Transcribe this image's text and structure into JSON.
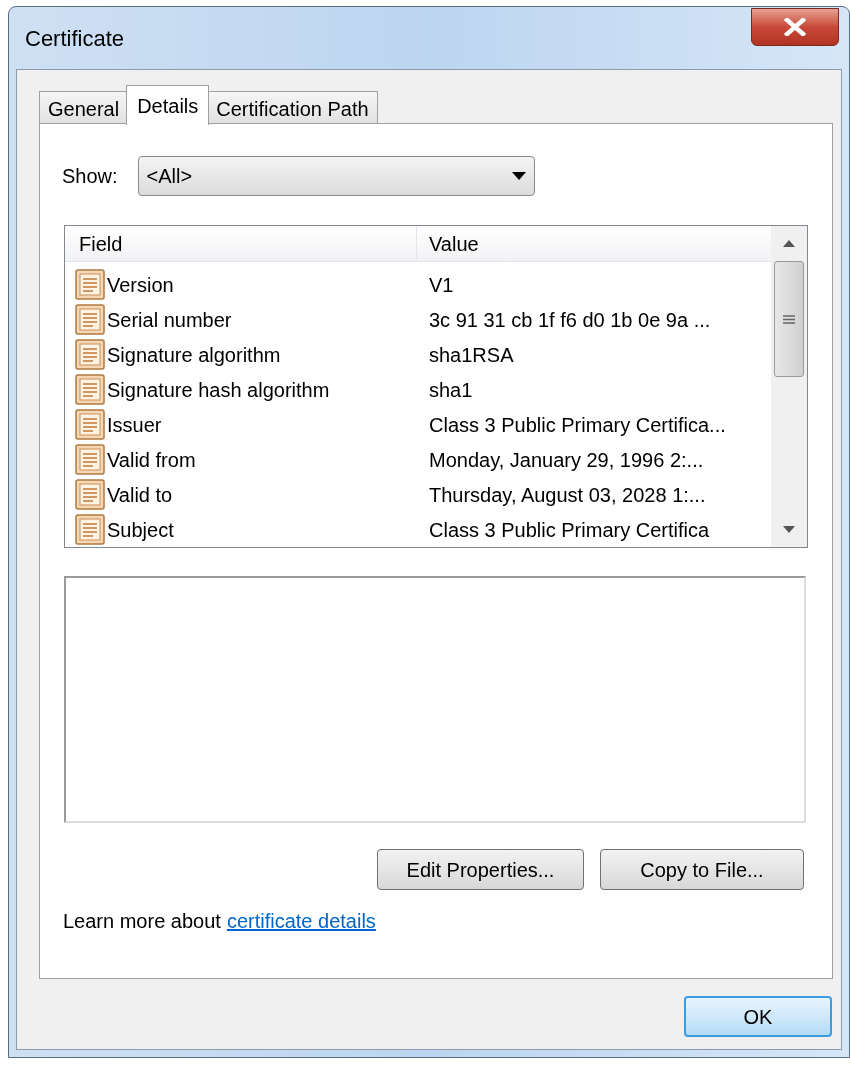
{
  "window": {
    "title": "Certificate"
  },
  "tabs": [
    {
      "label": "General",
      "selected": false
    },
    {
      "label": "Details",
      "selected": true
    },
    {
      "label": "Certification Path",
      "selected": false
    }
  ],
  "show": {
    "label": "Show:",
    "value": "<All>"
  },
  "list": {
    "columns": [
      "Field",
      "Value"
    ],
    "rows": [
      {
        "field": "Version",
        "value": "V1"
      },
      {
        "field": "Serial number",
        "value": "3c 91 31 cb 1f f6 d0 1b 0e 9a ..."
      },
      {
        "field": "Signature algorithm",
        "value": "sha1RSA"
      },
      {
        "field": "Signature hash algorithm",
        "value": "sha1"
      },
      {
        "field": "Issuer",
        "value": "Class 3 Public Primary Certifica..."
      },
      {
        "field": "Valid from",
        "value": "Monday, January 29, 1996 2:..."
      },
      {
        "field": "Valid to",
        "value": "Thursday, August 03, 2028 1:..."
      },
      {
        "field": "Subject",
        "value": "Class 3 Public Primary Certifica"
      }
    ]
  },
  "buttons": [
    "Edit Properties...",
    "Copy to File..."
  ],
  "learn_more": {
    "text": "Learn more about",
    "link": "certificate details"
  },
  "ok_button": "OK"
}
